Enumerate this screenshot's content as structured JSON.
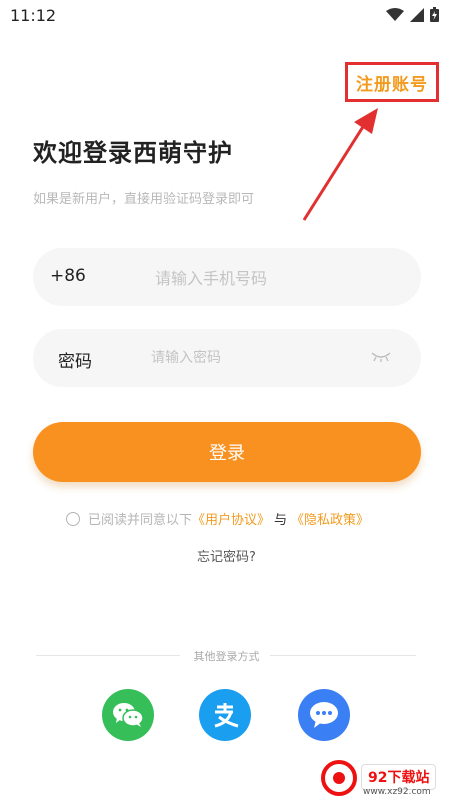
{
  "status_bar": {
    "time": "11:12"
  },
  "header": {
    "register_label": "注册账号"
  },
  "welcome": {
    "title": "欢迎登录西萌守护",
    "subtitle": "如果是新用户，直接用验证码登录即可"
  },
  "phone_field": {
    "prefix": "+86",
    "placeholder": "请输入手机号码"
  },
  "password_field": {
    "label": "密码",
    "placeholder": "请输入密码"
  },
  "login_button": {
    "label": "登录"
  },
  "agreement": {
    "prefix": "已阅读并同意以下",
    "user_agreement": "《用户协议》",
    "and": "与",
    "privacy_policy": "《隐私政策》"
  },
  "forgot_password": "忘记密码?",
  "other_login": {
    "label": "其他登录方式",
    "methods": [
      "wechat-icon",
      "alipay-icon",
      "chat-icon"
    ]
  },
  "watermark": {
    "tag": "92下载站",
    "url": "www.xz92.com"
  },
  "colors": {
    "accent": "#f99120",
    "link": "#f29b1f",
    "highlight_border": "#e23030"
  }
}
